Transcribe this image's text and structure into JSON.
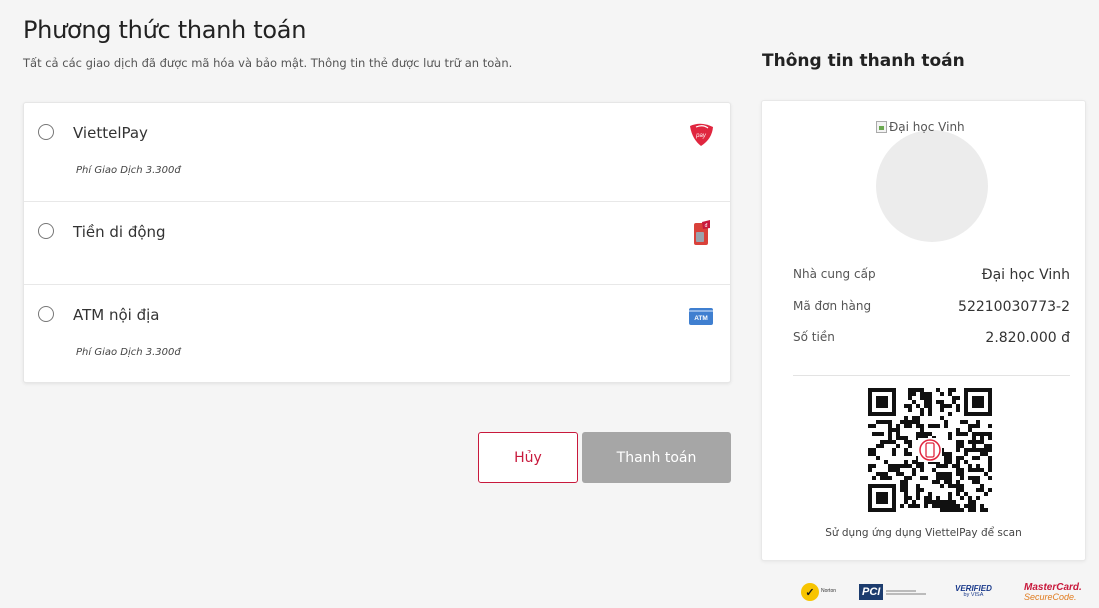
{
  "page": {
    "title": "Phương thức thanh toán",
    "subtitle": "Tất cả các giao dịch đã được mã hóa và bảo mật. Thông tin thẻ được lưu trữ an toàn."
  },
  "methods": [
    {
      "label": "ViettelPay",
      "fee": "Phí Giao Dịch 3.300đ",
      "icon": "viettelpay-icon",
      "selected": false
    },
    {
      "label": "Tiền di động",
      "fee": "",
      "icon": "mobile-money-icon",
      "selected": false
    },
    {
      "label": "ATM nội địa",
      "fee": "Phí Giao Dịch 3.300đ",
      "icon": "atm-icon",
      "icon_text": "ATM",
      "selected": false
    }
  ],
  "actions": {
    "cancel_label": "Hủy",
    "pay_label": "Thanh toán"
  },
  "summary": {
    "title": "Thông tin thanh toán",
    "logo_alt": "Đại học Vinh",
    "rows": [
      {
        "label": "Nhà cung cấp",
        "value": "Đại học Vinh"
      },
      {
        "label": "Mã đơn hàng",
        "value": "52210030773-2"
      },
      {
        "label": "Số tiền",
        "value": "2.820.000 đ"
      }
    ],
    "scan_text": "Sử dụng ứng dụng ViettelPay để scan"
  },
  "badges": {
    "norton": "Norton",
    "pci": "PCI",
    "visa_top": "VERIFIED",
    "visa_bottom": "by VISA",
    "mc_top": "MasterCard.",
    "mc_bottom": "SecureCode."
  },
  "colors": {
    "accent": "#c8193c",
    "pay_disabled": "#a6a6a6",
    "background": "#f5f5f5"
  }
}
